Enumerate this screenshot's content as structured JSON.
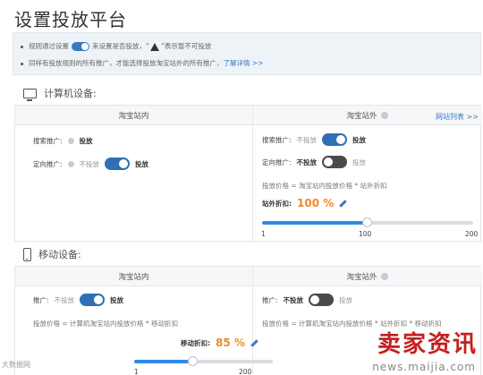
{
  "page": {
    "title": "设置投放平台"
  },
  "notice": {
    "line1_prefix": "规则通过设置",
    "line1_mid": "来设置是否投放，",
    "line1_warn": "表示暂不可投放",
    "line2_text": "同样有投放规则的所有推广，才能选择投放淘宝站外的所有推广，",
    "line2_link": "了解详情 >>"
  },
  "pc": {
    "section_label": "计算机设备:",
    "inside": {
      "header": "淘宝站内",
      "search_label": "搜索推广:",
      "search_value": "投放",
      "directional_label": "定向推广:",
      "directional_off": "不投放",
      "directional_on": "投放"
    },
    "outside": {
      "header": "淘宝站外",
      "link": "网站列表 >>",
      "search_label": "搜索推广:",
      "search_off": "不投放",
      "search_on": "投放",
      "directional_label": "定向推广:",
      "directional_off": "不投放",
      "directional_on": "投放",
      "formula": "投放价格 = 淘宝站内投放价格 * 站外折扣",
      "discount_label": "站外折扣:",
      "discount_value": "100 %",
      "slider_value": 100,
      "ticks": [
        "1",
        "100",
        "200"
      ]
    }
  },
  "mobile": {
    "section_label": "移动设备:",
    "inside": {
      "header": "淘宝站内",
      "promo_label": "推广:",
      "promo_off": "不投放",
      "promo_on": "投放",
      "formula": "投放价格 = 计算机淘宝站内投放价格 * 移动折扣",
      "discount_label": "移动折扣:",
      "discount_value": "85 %",
      "slider_value": 85,
      "ticks": [
        "1",
        "200"
      ]
    },
    "outside": {
      "header": "淘宝站外",
      "promo_label": "推广:",
      "promo_off": "不投放",
      "promo_on": "投放",
      "formula": "投放价格 = 计算机淘宝站内投放价格 * 站外折扣 * 移动折扣"
    }
  },
  "watermark": {
    "left": "大数据网",
    "brand": "卖家资讯",
    "url": "news.maijia.com"
  },
  "colors": {
    "accent": "#2f6fb5",
    "percent": "#f08a24",
    "link": "#3a78c3",
    "brand": "#c41f1f"
  }
}
